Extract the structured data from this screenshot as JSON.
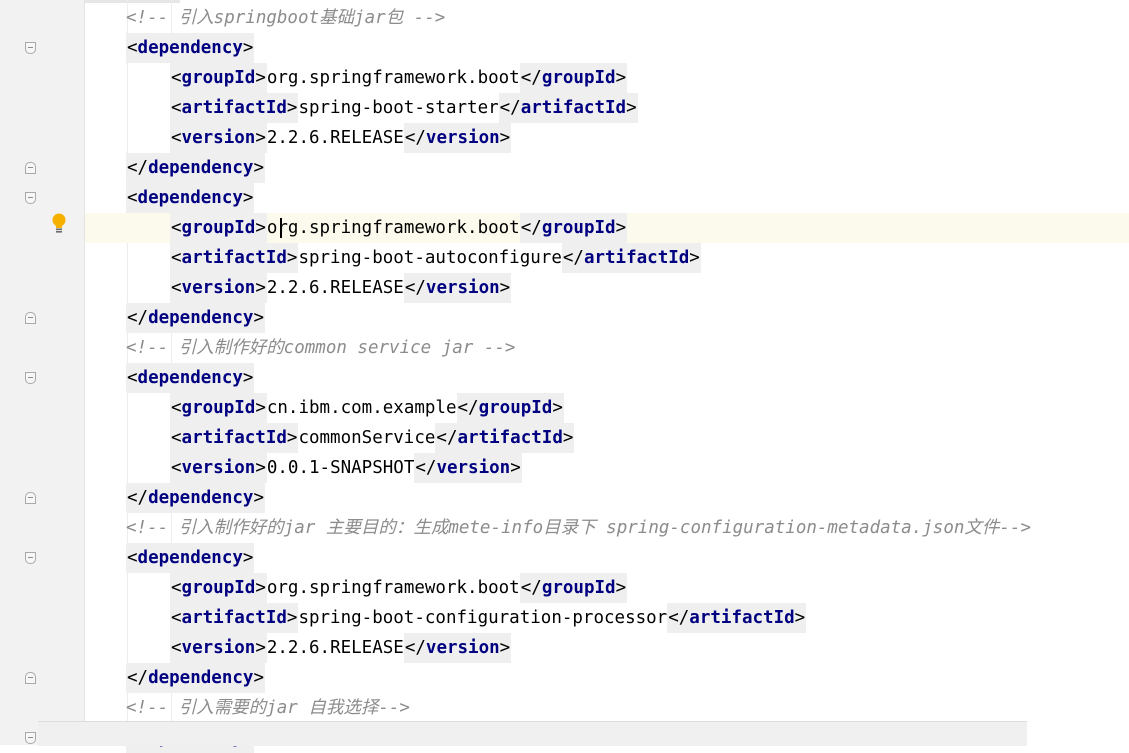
{
  "editor": {
    "language": "xml",
    "current_line_index": 7,
    "lines": [
      {
        "type": "comment",
        "text": "<!-- 引入springboot基础jar包 -->"
      },
      {
        "type": "open",
        "tag": "dependency"
      },
      {
        "type": "elem",
        "tag": "groupId",
        "value": "org.springframework.boot"
      },
      {
        "type": "elem",
        "tag": "artifactId",
        "value": "spring-boot-starter"
      },
      {
        "type": "elem",
        "tag": "version",
        "value": "2.2.6.RELEASE"
      },
      {
        "type": "close",
        "tag": "dependency"
      },
      {
        "type": "open",
        "tag": "dependency"
      },
      {
        "type": "elem",
        "tag": "groupId",
        "value": "org.springframework.boot"
      },
      {
        "type": "elem",
        "tag": "artifactId",
        "value": "spring-boot-autoconfigure"
      },
      {
        "type": "elem",
        "tag": "version",
        "value": "2.2.6.RELEASE"
      },
      {
        "type": "close",
        "tag": "dependency"
      },
      {
        "type": "comment",
        "text": "<!-- 引入制作好的common service jar -->"
      },
      {
        "type": "open",
        "tag": "dependency"
      },
      {
        "type": "elem",
        "tag": "groupId",
        "value": "cn.ibm.com.example"
      },
      {
        "type": "elem",
        "tag": "artifactId",
        "value": "commonService"
      },
      {
        "type": "elem",
        "tag": "version",
        "value": "0.0.1-SNAPSHOT"
      },
      {
        "type": "close",
        "tag": "dependency"
      },
      {
        "type": "comment",
        "text": "<!-- 引入制作好的jar 主要目的：生成mete-info目录下 spring-configuration-metadata.json文件-->"
      },
      {
        "type": "open",
        "tag": "dependency"
      },
      {
        "type": "elem",
        "tag": "groupId",
        "value": "org.springframework.boot"
      },
      {
        "type": "elem",
        "tag": "artifactId",
        "value": "spring-boot-configuration-processor"
      },
      {
        "type": "elem",
        "tag": "version",
        "value": "2.2.6.RELEASE"
      },
      {
        "type": "close",
        "tag": "dependency"
      },
      {
        "type": "comment",
        "text": "<!-- 引入需要的jar 自我选择-->"
      },
      {
        "type": "open",
        "tag": "dependency"
      }
    ]
  },
  "gutter": {
    "intention_icon": "lightbulb-icon"
  },
  "colors": {
    "tag_name": "#000080",
    "comment": "#8c8c8c",
    "current_line": "#fcfaed",
    "tag_highlight": "#efefef"
  }
}
